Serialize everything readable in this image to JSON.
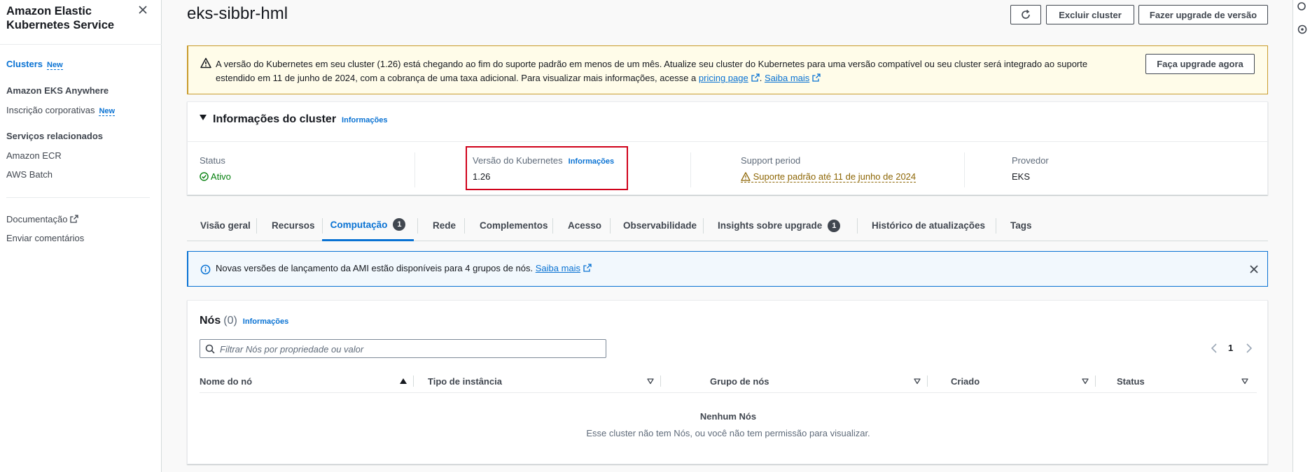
{
  "sidebar": {
    "title": "Amazon Elastic Kubernetes Service",
    "items": [
      {
        "label": "Clusters",
        "badge": "New"
      },
      {
        "label": "Amazon EKS Anywhere"
      },
      {
        "label": "Inscrição corporativas",
        "badge": "New"
      },
      {
        "label": "Serviços relacionados"
      },
      {
        "label": "Amazon ECR"
      },
      {
        "label": "AWS Batch"
      },
      {
        "label": "Documentação"
      },
      {
        "label": "Enviar comentários"
      }
    ]
  },
  "header": {
    "title": "eks-sibbr-hml",
    "delete_label": "Excluir cluster",
    "upgrade_label": "Fazer upgrade de versão"
  },
  "warning": {
    "text_before": "A versão do Kubernetes em seu cluster (1.26) está chegando ao fim do suporte padrão em menos de um mês. Atualize seu cluster do Kubernetes para uma versão compatível ou seu cluster será integrado ao suporte estendido em 11 de junho de 2024, com a cobrança de uma taxa adicional. Para visualizar mais informações, acesse a ",
    "link1": "pricing page",
    "sep": ". ",
    "link2": "Saiba mais",
    "button": "Faça upgrade agora"
  },
  "cluster": {
    "title": "Informações do cluster",
    "info_link": "Informações",
    "status_label": "Status",
    "status_value": "Ativo",
    "version_label": "Versão do Kubernetes",
    "version_info": "Informações",
    "version_value": "1.26",
    "support_label": "Support period",
    "support_value": "Suporte padrão até 11 de junho de 2024",
    "provider_label": "Provedor",
    "provider_value": "EKS"
  },
  "tabs": [
    {
      "label": "Visão geral"
    },
    {
      "label": "Recursos"
    },
    {
      "label": "Computação",
      "count": "1"
    },
    {
      "label": "Rede"
    },
    {
      "label": "Complementos"
    },
    {
      "label": "Acesso"
    },
    {
      "label": "Observabilidade"
    },
    {
      "label": "Insights sobre upgrade",
      "count": "1"
    },
    {
      "label": "Histórico de atualizações"
    },
    {
      "label": "Tags"
    }
  ],
  "ami_banner": {
    "text": "Novas versões de lançamento da AMI estão disponíveis para 4 grupos de nós. ",
    "link": "Saiba mais"
  },
  "nodes": {
    "title": "Nós",
    "count": "(0)",
    "info_link": "Informações",
    "filter_placeholder": "Filtrar Nós por propriedade ou valor",
    "page": "1",
    "columns": [
      "Nome do nó",
      "Tipo de instância",
      "Grupo de nós",
      "Criado",
      "Status"
    ],
    "empty_title": "Nenhum Nós",
    "empty_desc": "Esse cluster não tem Nós, ou você não tem permissão para visualizar."
  },
  "colors": {
    "accent": "#0972d3",
    "success": "#037f0c",
    "warning": "#8d6605",
    "highlight": "#d0021b"
  }
}
